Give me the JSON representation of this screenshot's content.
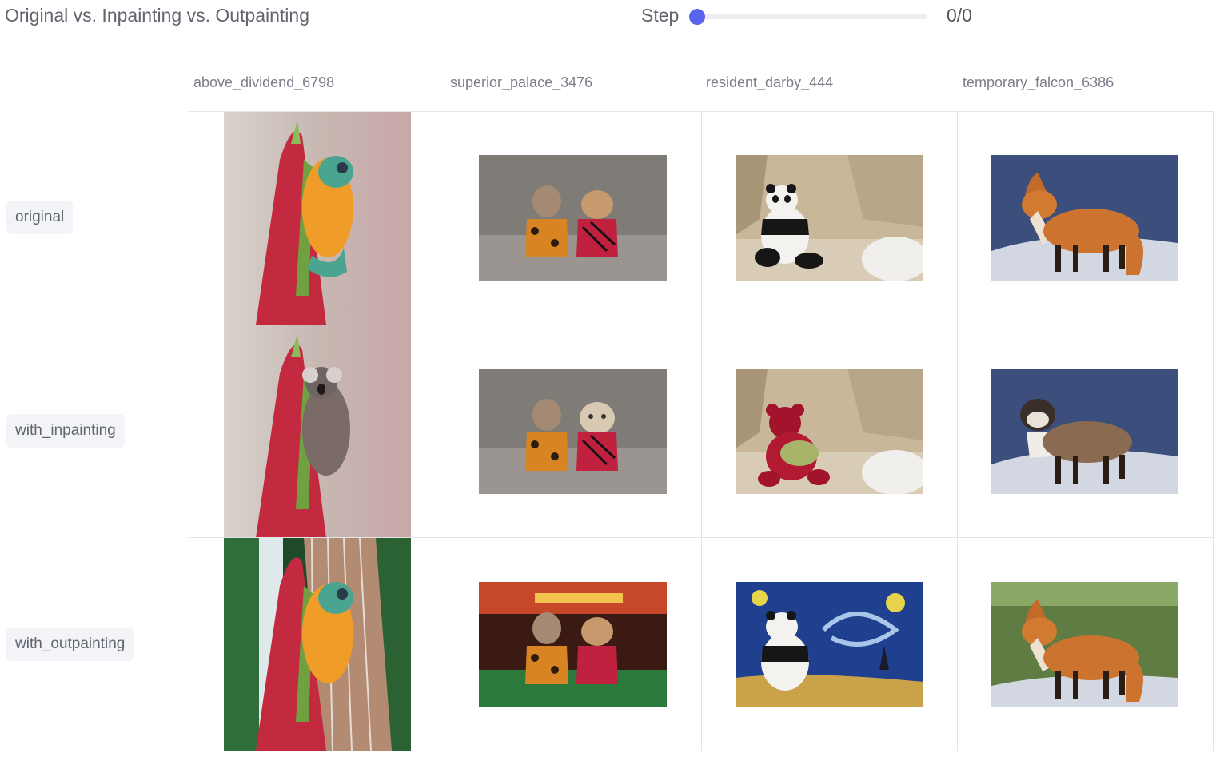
{
  "header": {
    "title": "Original vs. Inpainting vs. Outpainting",
    "step_label": "Step",
    "step_value": "0/0",
    "step_fraction": 0
  },
  "columns": [
    "above_dividend_6798",
    "superior_palace_3476",
    "resident_darby_444",
    "temporary_falcon_6386"
  ],
  "rows": [
    "original",
    "with_inpainting",
    "with_outpainting"
  ],
  "images": [
    [
      "frog-on-red-flower",
      "two-dogs-in-jackets",
      "panda-on-rocks",
      "red-fox-on-snow"
    ],
    [
      "koala-on-red-flower",
      "dog-and-old-man-dog",
      "red-teddy-bear",
      "bulldog-fox-hybrid"
    ],
    [
      "frog-with-waterfall",
      "dogs-in-casino",
      "panda-starry-night",
      "fox-on-grass"
    ]
  ],
  "colors": {
    "accent": "#5a63ec",
    "grid_line": "#e3e4ea",
    "label_bg": "#f3f4f7"
  }
}
